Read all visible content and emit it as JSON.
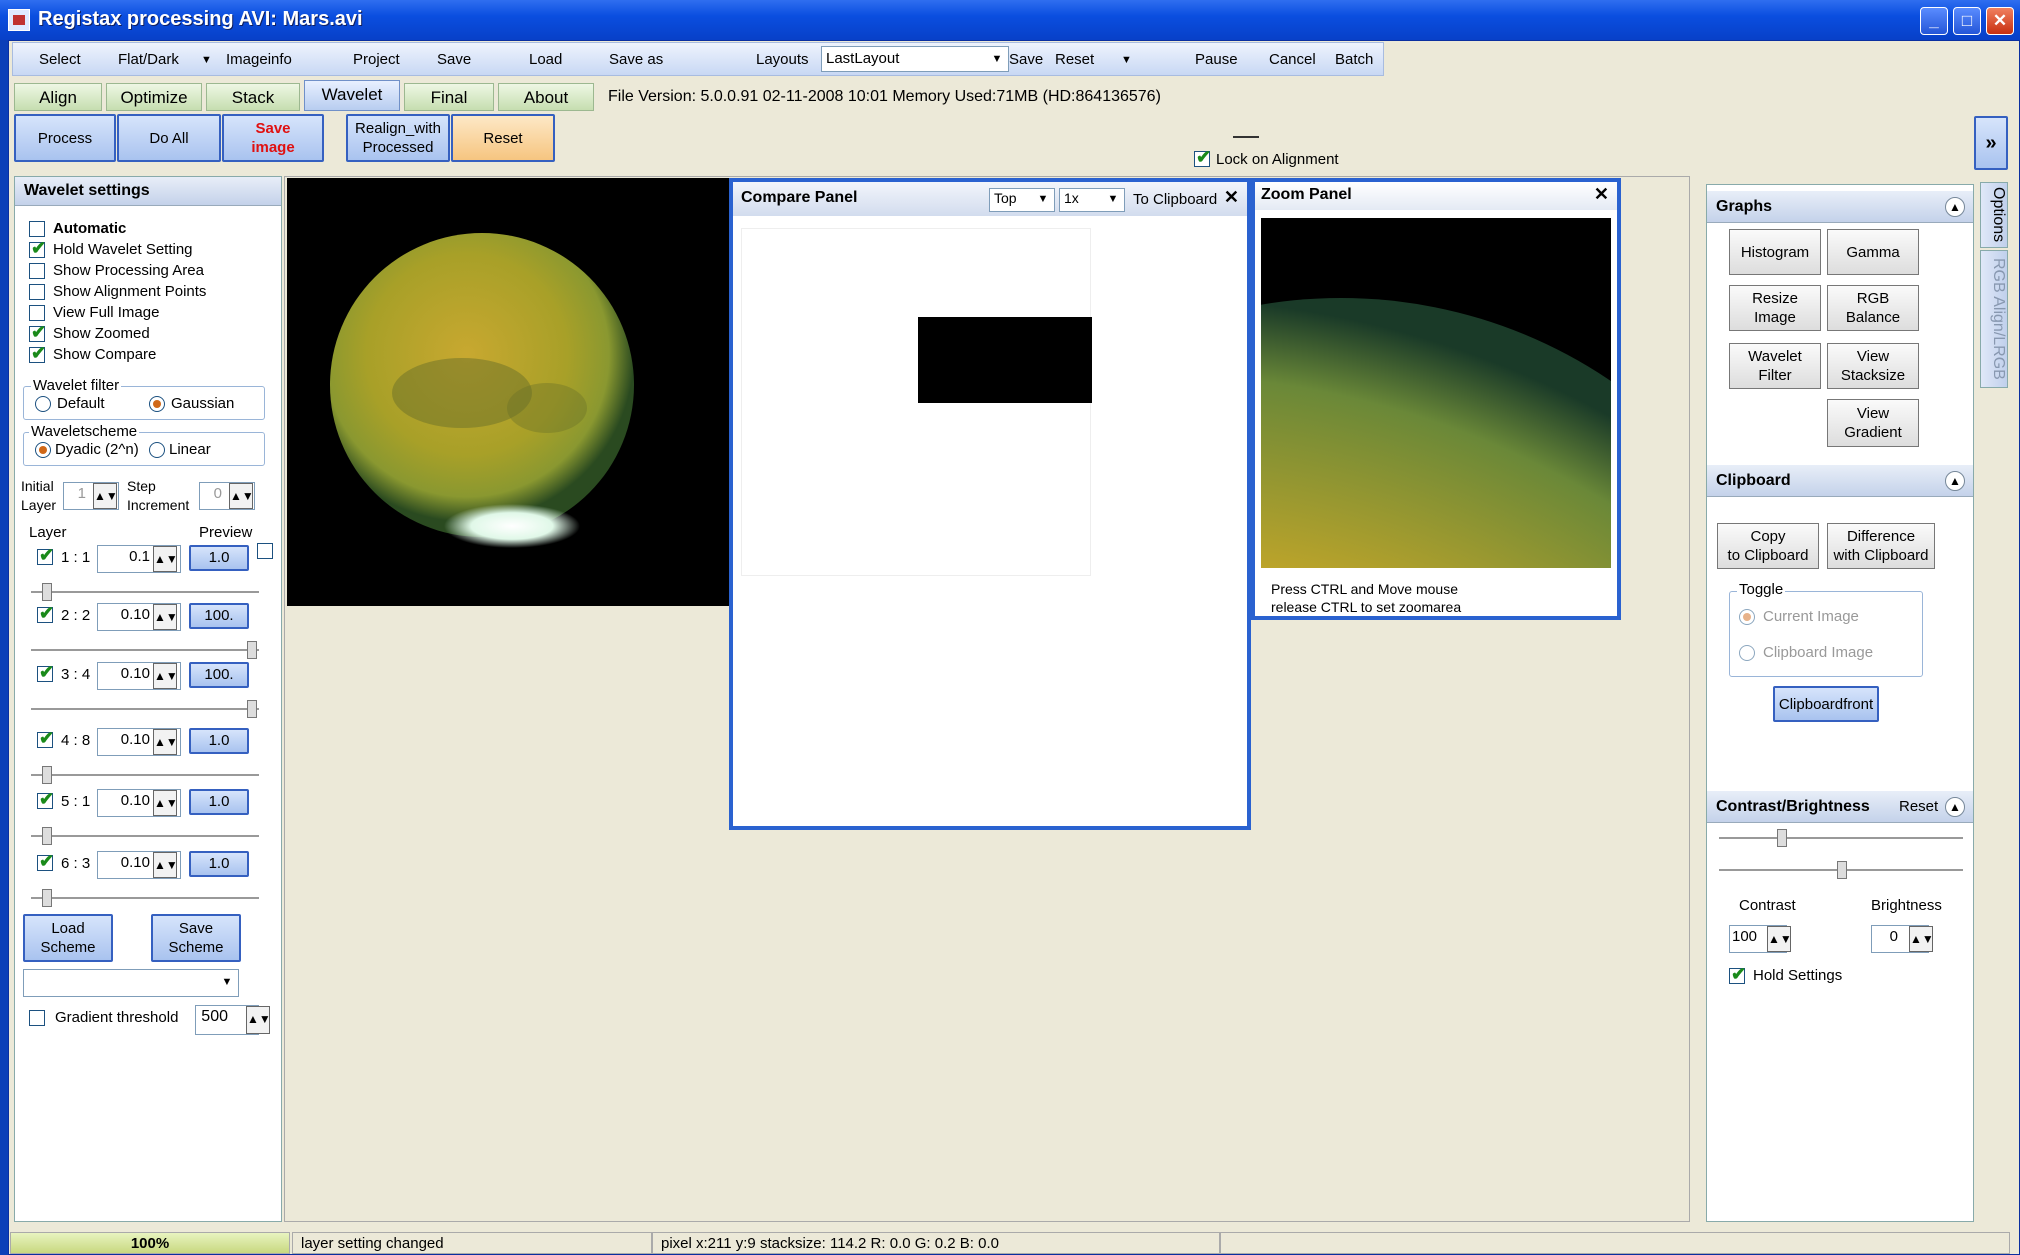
{
  "window": {
    "title": "Registax processing AVI: Mars.avi",
    "min": "_",
    "max": "□",
    "close": "✕"
  },
  "menu": {
    "select": "Select",
    "flatdark": "Flat/Dark",
    "imageinfo": "Imageinfo",
    "project": "Project",
    "save": "Save",
    "load": "Load",
    "saveas": "Save as",
    "layouts": "Layouts",
    "layout_value": "LastLayout",
    "layout_save": "Save",
    "layout_reset": "Reset",
    "pause": "Pause",
    "cancel": "Cancel",
    "batch": "Batch"
  },
  "tabs": [
    "Align",
    "Optimize",
    "Stack",
    "Wavelet",
    "Final",
    "About"
  ],
  "fileinfo": "File Version: 5.0.0.91     02-11-2008 10:01   Memory Used:71MB  (HD:864136576)",
  "toolbar": {
    "process": "Process",
    "doall": "Do All",
    "save_image_1": "Save",
    "save_image_2": "image",
    "realign_1": "Realign_with",
    "realign_2": "Processed",
    "reset": "Reset",
    "lock_alignment": "Lock on Alignment",
    "expand": "»"
  },
  "wavelet": {
    "title": "Wavelet settings",
    "automatic": "Automatic",
    "hold": "Hold Wavelet Setting",
    "show_proc": "Show Processing Area",
    "show_align": "Show Alignment Points",
    "view_full": "View Full Image",
    "show_zoomed": "Show Zoomed",
    "show_compare": "Show Compare",
    "filter_title": "Wavelet filter",
    "filter_default": "Default",
    "filter_gaussian": "Gaussian",
    "scheme_title": "Waveletscheme",
    "scheme_dyadic": "Dyadic (2^n)",
    "scheme_linear": "Linear",
    "initial_1": "Initial",
    "initial_2": "Layer",
    "initial_value": "1",
    "step_1": "Step",
    "step_2": "Increment",
    "step_value": "0",
    "layer_header": "Layer",
    "preview_header": "Preview",
    "layers": [
      {
        "label": "1 : 1",
        "value": "0.1",
        "preview": "1.0",
        "slider": 0.05
      },
      {
        "label": "2 : 2",
        "value": "0.10",
        "preview": "100.",
        "slider": 1.0
      },
      {
        "label": "3 : 4",
        "value": "0.10",
        "preview": "100.",
        "slider": 1.0
      },
      {
        "label": "4 : 8",
        "value": "0.10",
        "preview": "1.0",
        "slider": 0.05
      },
      {
        "label": "5 : 1",
        "value": "0.10",
        "preview": "1.0",
        "slider": 0.05
      },
      {
        "label": "6 : 3",
        "value": "0.10",
        "preview": "1.0",
        "slider": 0.05
      }
    ],
    "load_scheme_1": "Load",
    "load_scheme_2": "Scheme",
    "save_scheme_1": "Save",
    "save_scheme_2": "Scheme",
    "gradient": "Gradient threshold",
    "gradient_value": "500"
  },
  "compare": {
    "title": "Compare Panel",
    "position": "Top",
    "zoom": "1x",
    "clipboard": "To Clipboard",
    "close": "✕"
  },
  "zoompanel": {
    "title": "Zoom Panel",
    "close": "✕",
    "hint_1": "Press CTRL and Move mouse",
    "hint_2": "release CTRL to set zoomarea"
  },
  "graphs": {
    "title": "Graphs",
    "histogram": "Histogram",
    "gamma": "Gamma",
    "resize_1": "Resize",
    "resize_2": "Image",
    "rgb_1": "RGB",
    "rgb_2": "Balance",
    "wfilter_1": "Wavelet",
    "wfilter_2": "Filter",
    "vstack_1": "View",
    "vstack_2": "Stacksize",
    "vgrad_1": "View",
    "vgrad_2": "Gradient"
  },
  "clipboard": {
    "title": "Clipboard",
    "copy_1": "Copy",
    "copy_2": "to Clipboard",
    "diff_1": "Difference",
    "diff_2": "with Clipboard",
    "toggle": "Toggle",
    "current": "Current Image",
    "clip_image": "Clipboard Image",
    "front": "Clipboardfront"
  },
  "contrast": {
    "title": "Contrast/Brightness",
    "reset": "Reset",
    "contrast_label": "Contrast",
    "brightness_label": "Brightness",
    "contrast_value": "100",
    "brightness_value": "0",
    "hold": "Hold Settings"
  },
  "side_tabs": {
    "options": "Options",
    "rgb": "RGB Align/LRGB"
  },
  "status": {
    "progress": "100%",
    "message": "layer setting changed",
    "pixel": "pixel x:211 y:9 stacksize: 114.2 R: 0.0 G: 0.2 B: 0.0"
  },
  "colors": {
    "title_bar": "#0a4ee0",
    "accent_blue": "#2a62d0",
    "save_red": "#e01010",
    "reset_orange": "#fbd8a0",
    "check_green": "#1a8a1a"
  }
}
